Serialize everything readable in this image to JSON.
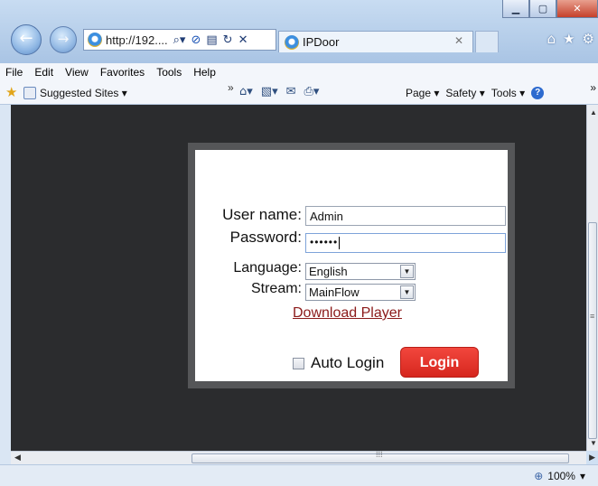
{
  "browser": {
    "address": "http://192....",
    "tab_title": "IPDoor",
    "menu": [
      "File",
      "Edit",
      "View",
      "Favorites",
      "Tools",
      "Help"
    ],
    "favorites_label": "Suggested Sites ▾",
    "commands": {
      "page": "Page ▾",
      "safety": "Safety ▾",
      "tools": "Tools ▾"
    },
    "zoom": "100%"
  },
  "login": {
    "username_label": "User name:",
    "username_value": "Admin",
    "password_label": "Password:",
    "password_value": "••••••",
    "language_label": "Language:",
    "language_value": "English",
    "stream_label": "Stream:",
    "stream_value": "MainFlow",
    "download_link": "Download Player",
    "auto_login_label": "Auto Login",
    "login_button": "Login"
  },
  "colors": {
    "login_button": "#e8352c",
    "content_bg": "#2b2c2e",
    "download_link": "#8b1a1a"
  }
}
